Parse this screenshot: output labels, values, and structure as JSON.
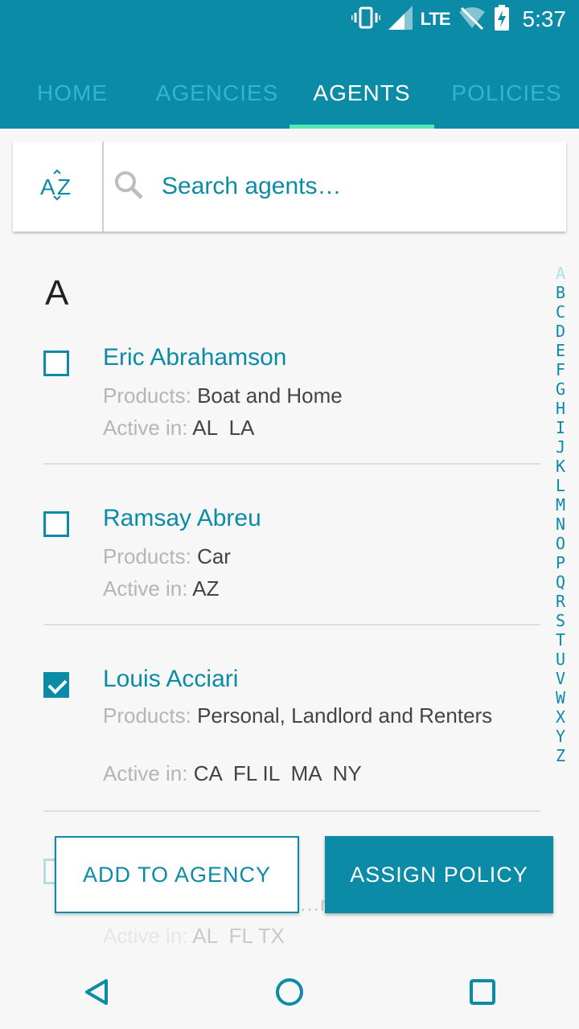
{
  "status": {
    "lte": "LTE",
    "time": "5:37"
  },
  "tabs": [
    {
      "label": "HOME"
    },
    {
      "label": "AGENCIES"
    },
    {
      "label": "AGENTS"
    },
    {
      "label": "POLICIES"
    }
  ],
  "search": {
    "placeholder": "Search agents…",
    "sort_icon": "az-sort-icon",
    "search_icon": "search-icon"
  },
  "section": {
    "letter": "A"
  },
  "index": [
    "A",
    "B",
    "C",
    "D",
    "E",
    "F",
    "G",
    "H",
    "I",
    "J",
    "K",
    "L",
    "M",
    "N",
    "O",
    "P",
    "Q",
    "R",
    "S",
    "T",
    "U",
    "V",
    "W",
    "X",
    "Y",
    "Z"
  ],
  "labels": {
    "products": "Products:",
    "active": "Active in:"
  },
  "agents": [
    {
      "name": "Eric Abrahamson",
      "products": "Boat and Home",
      "active": "AL  LA",
      "checked": false
    },
    {
      "name": "Ramsay Abreu",
      "products": "Car",
      "active": "AZ",
      "checked": false
    },
    {
      "name": "Louis Acciari",
      "products": "Personal, Landlord and Renters",
      "active": "CA  FL IL  MA  NY",
      "checked": true
    },
    {
      "name": "",
      "products": "…rb",
      "active": "AL  FL TX",
      "checked": false
    }
  ],
  "actions": {
    "add": "ADD TO AGENCY",
    "assign": "ASSIGN POLICY"
  },
  "colors": {
    "primary": "#0b8ba6",
    "tab_indicator": "#55e7b8"
  }
}
